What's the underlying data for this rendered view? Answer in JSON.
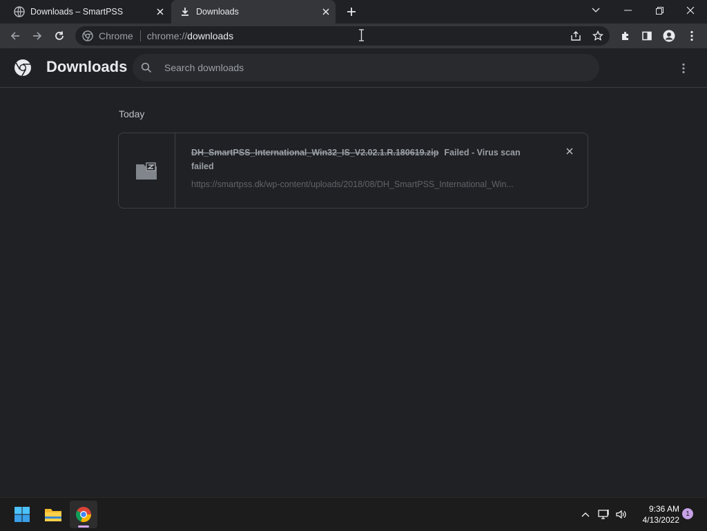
{
  "tabs": [
    {
      "title": "Downloads – SmartPSS",
      "icon": "globe-icon",
      "active": false
    },
    {
      "title": "Downloads",
      "icon": "download-icon",
      "active": true
    }
  ],
  "omnibox": {
    "chip": "Chrome",
    "url_scheme": "chrome://",
    "url_host": "downloads"
  },
  "page": {
    "title": "Downloads",
    "search_placeholder": "Search downloads"
  },
  "downloads": {
    "date_header": "Today",
    "items": [
      {
        "filename": "DH_SmartPSS_International_Win32_IS_V2.02.1.R.180619.zip",
        "status": "Failed - Virus scan failed",
        "url": "https://smartpss.dk/wp-content/uploads/2018/08/DH_SmartPSS_International_Win..."
      }
    ]
  },
  "taskbar": {
    "time": "9:36 AM",
    "date": "4/13/2022",
    "notifications": "1"
  },
  "colors": {
    "background": "#202124",
    "toolbar": "#35363a",
    "text": "#e8eaed",
    "muted": "#9aa0a6"
  }
}
